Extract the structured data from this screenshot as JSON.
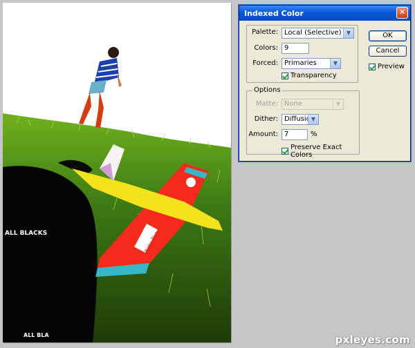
{
  "dialog": {
    "title": "Indexed Color",
    "palette": {
      "label": "Palette:",
      "value": "Local (Selective)"
    },
    "colors": {
      "label": "Colors:",
      "value": "9"
    },
    "forced": {
      "label": "Forced:",
      "value": "Primaries"
    },
    "transparency": {
      "label": "Transparency",
      "checked": true
    },
    "options": {
      "legend": "Options",
      "matte": {
        "label": "Matte:",
        "value": "None",
        "disabled": true
      },
      "dither": {
        "label": "Dither:",
        "value": "Diffusion"
      },
      "amount": {
        "label": "Amount:",
        "value": "7",
        "unit": "%"
      },
      "preserve": {
        "label": "Preserve Exact Colors",
        "checked": true
      }
    },
    "buttons": {
      "ok": "OK",
      "cancel": "Cancel"
    },
    "preview": {
      "label": "Preview",
      "checked": true
    },
    "close_glyph": "✕"
  },
  "photo": {
    "shirt_text": "ALL BLACKS",
    "shirt_text_bottom": "ALL BLA",
    "plane_brand": "Baby Roo",
    "colors": {
      "sky": "#ffffff",
      "grass": "#3f7a19",
      "plane_body": "#f42a1c",
      "wing": "#f3e21c",
      "stripe": "#37b7c5"
    }
  },
  "watermark": "pxleyes.com"
}
